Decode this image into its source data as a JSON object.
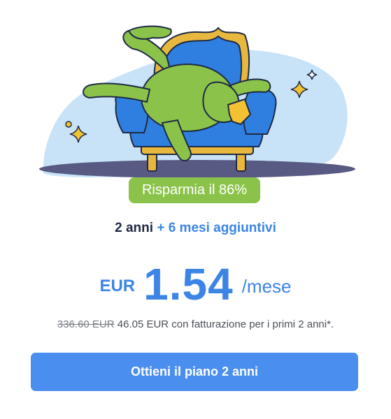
{
  "offer": {
    "savings_badge": "Risparmia il 86%",
    "plan_term": "2 anni",
    "plan_bonus": "+ 6 mesi aggiuntivi",
    "currency": "EUR",
    "price": "1.54",
    "period": "/mese",
    "original_price": "336.60 EUR",
    "billing_text": "46.05 EUR con fatturazione per i primi 2 anni*.",
    "cta_label": "Ottieni il piano 2 anni"
  },
  "colors": {
    "accent": "#3c85e6",
    "badge": "#8bc34a",
    "button": "#4a8ef0"
  }
}
